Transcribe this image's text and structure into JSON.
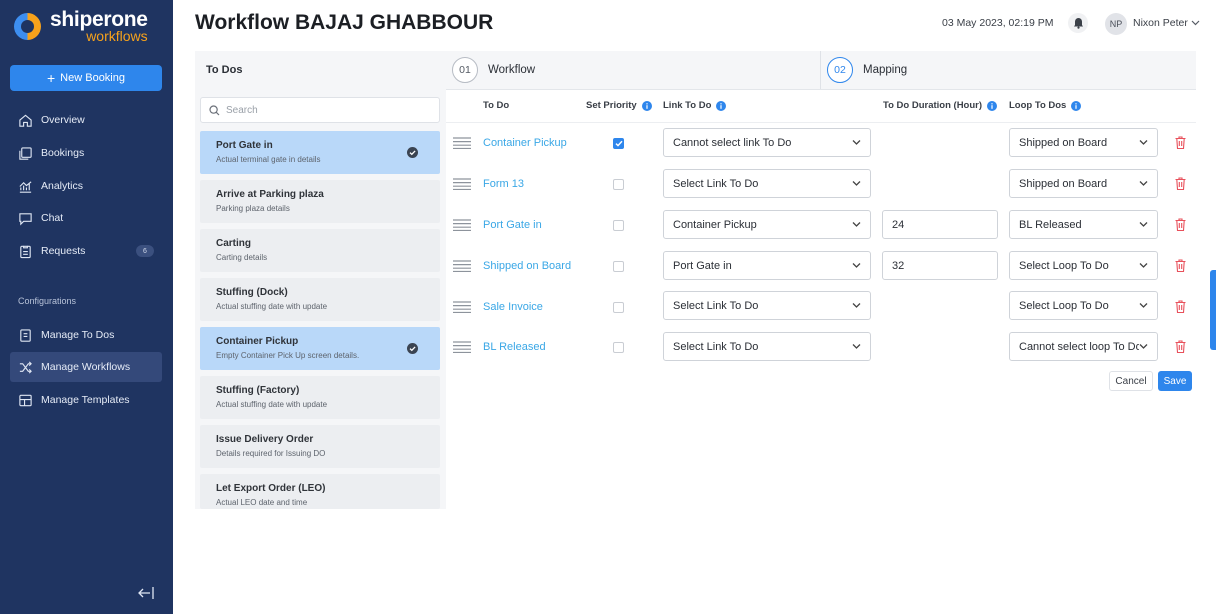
{
  "brand": {
    "name": "shiperone",
    "sub": "workflows"
  },
  "sidebar": {
    "new_booking": "New Booking",
    "items": [
      {
        "label": "Overview",
        "icon": "home-icon"
      },
      {
        "label": "Bookings",
        "icon": "bookings-icon"
      },
      {
        "label": "Analytics",
        "icon": "analytics-icon"
      },
      {
        "label": "Chat",
        "icon": "chat-icon"
      },
      {
        "label": "Requests",
        "icon": "requests-icon",
        "badge": "6"
      }
    ],
    "section_label": "Configurations",
    "config_items": [
      {
        "label": "Manage To Dos",
        "icon": "manage-todos-icon"
      },
      {
        "label": "Manage Workflows",
        "icon": "workflows-icon",
        "active": true
      },
      {
        "label": "Manage Templates",
        "icon": "templates-icon"
      }
    ]
  },
  "header": {
    "title": "Workflow BAJAJ GHABBOUR",
    "datetime": "03 May 2023, 02:19 PM",
    "user_initials": "NP",
    "user_name": "Nixon Peter"
  },
  "todos_panel": {
    "heading": "To Dos",
    "search_placeholder": "Search",
    "items": [
      {
        "title": "Port Gate in",
        "desc": "Actual terminal gate in details",
        "selected": true
      },
      {
        "title": "Arrive at Parking plaza",
        "desc": "Parking plaza details",
        "selected": false
      },
      {
        "title": "Carting",
        "desc": "Carting details",
        "selected": false
      },
      {
        "title": "Stuffing (Dock)",
        "desc": "Actual stuffing date with update",
        "selected": false
      },
      {
        "title": "Container Pickup",
        "desc": "Empty Container Pick Up screen details.",
        "selected": true
      },
      {
        "title": "Stuffing (Factory)",
        "desc": "Actual stuffing date with update",
        "selected": false
      },
      {
        "title": "Issue Delivery Order",
        "desc": "Details required for Issuing DO",
        "selected": false
      },
      {
        "title": "Let Export Order (LEO)",
        "desc": "Actual LEO date and time",
        "selected": false
      }
    ]
  },
  "steps": [
    {
      "num": "01",
      "label": "Workflow"
    },
    {
      "num": "02",
      "label": "Mapping",
      "active": true
    }
  ],
  "table": {
    "headers": {
      "todo": "To Do",
      "priority": "Set Priority",
      "link": "Link To Do",
      "duration": "To Do Duration (Hour)",
      "loop": "Loop To Dos"
    },
    "rows": [
      {
        "todo": "Container Pickup",
        "priority": true,
        "link": "Cannot select link To Do",
        "duration": null,
        "loop": "Shipped on Board"
      },
      {
        "todo": "Form 13",
        "priority": false,
        "link": "Select Link To Do",
        "duration": null,
        "loop": "Shipped on Board"
      },
      {
        "todo": "Port Gate in",
        "priority": false,
        "link": "Container Pickup",
        "duration": "24",
        "loop": "BL Released"
      },
      {
        "todo": "Shipped on Board",
        "priority": false,
        "link": "Port Gate in",
        "duration": "32",
        "loop": "Select Loop To Do"
      },
      {
        "todo": "Sale Invoice",
        "priority": false,
        "link": "Select Link To Do",
        "duration": null,
        "loop": "Select Loop To Do"
      },
      {
        "todo": "BL Released",
        "priority": false,
        "link": "Select Link To Do",
        "duration": null,
        "loop": "Cannot select loop To Do"
      }
    ]
  },
  "actions": {
    "cancel": "Cancel",
    "save": "Save"
  },
  "colors": {
    "sidebar": "#1f3461",
    "accent": "#2e86ec",
    "link": "#3aa7e6",
    "danger": "#e8505b",
    "selected_card": "#b9d8f9"
  }
}
